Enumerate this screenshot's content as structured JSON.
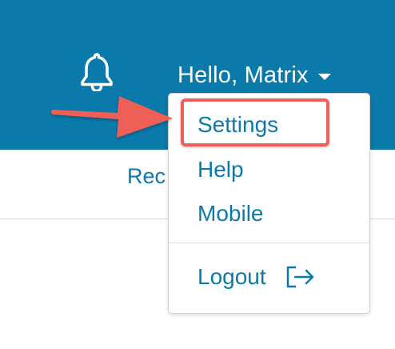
{
  "header": {
    "greeting": "Hello, Matrix",
    "bell_icon": "bell-icon",
    "caret_icon": "caret-down-icon",
    "background_color": "#0a7aab"
  },
  "subbar": {
    "partial_link": "Rec"
  },
  "dropdown": {
    "items": [
      {
        "label": "Settings"
      },
      {
        "label": "Help"
      },
      {
        "label": "Mobile"
      }
    ],
    "logout": {
      "label": "Logout",
      "icon": "logout-icon"
    }
  },
  "annotation": {
    "highlight_color": "#ee5f57",
    "arrow_color": "#ee5f57",
    "target": "Settings"
  }
}
